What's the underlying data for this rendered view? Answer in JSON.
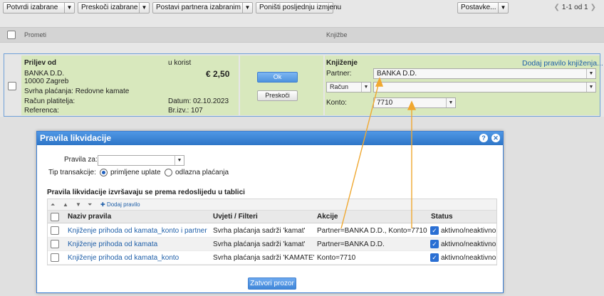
{
  "toolbar": {
    "confirm_selected": "Potvrdi izabrane",
    "skip_selected": "Preskoči izabrane",
    "set_partner": "Postavi partnera izabranim",
    "undo_last": "Poništi posljednju izmjenu",
    "settings": "Postavke...",
    "pager": "1-1 od 1"
  },
  "list_header": {
    "left": "Prometi",
    "right": "Knjižbe"
  },
  "transaction": {
    "inflow_label": "Priljev od",
    "benefit_label": "u korist",
    "amount": "€ 2,50",
    "payer_name": "BANKA D.D.",
    "payer_address": "10000 Zagreb",
    "purpose": "Svrha plaćanja: Redovne kamate",
    "payer_account_label": "Račun platitelja:",
    "reference_label": "Referenca:",
    "date": "Datum: 02.10.2023",
    "statement_no": "Br.izv.: 107",
    "ok_button": "Ok",
    "skip_button": "Preskoči",
    "posting_title": "Knjiženje",
    "add_rule_link": "Dodaj pravilo knjiženja...",
    "partner_label": "Partner:",
    "partner_value": "BANKA D.D.",
    "account_type": "Račun",
    "konto_label": "Konto:",
    "konto_value": "7710"
  },
  "modal": {
    "title": "Pravila likvidacije",
    "rules_for_label": "Pravila za:",
    "rules_for_value": "",
    "tx_type_label": "Tip transakcije:",
    "radio_in": "primljene uplate",
    "radio_out": "odlazna plaćanja",
    "order_note": "Pravila likvidacije izvršavaju se prema redoslijedu u tablici",
    "add_rule": "Dodaj pravilo",
    "columns": [
      "Naziv pravila",
      "Uvjeti / Filteri",
      "Akcije",
      "Status"
    ],
    "rows": [
      {
        "name": "Knjiženje prihoda od kamata_konto i partner",
        "filter": "Svrha plaćanja sadrži 'kamat'",
        "action": "Partner=BANKA D.D., Konto=7710",
        "status": "aktivno/neaktivno"
      },
      {
        "name": "Knjiženje prihoda od kamata",
        "filter": "Svrha plaćanja sadrži 'kamat'",
        "action": "Partner=BANKA D.D.",
        "status": "aktivno/neaktivno"
      },
      {
        "name": "Knjiženje prihoda od kamata_konto",
        "filter": "Svrha plaćanja sadrži 'KAMATE'",
        "action": "Konto=7710",
        "status": "aktivno/neaktivno"
      }
    ],
    "close_button": "Zatvori prozor"
  },
  "colors": {
    "accent": "#2e75c7",
    "panel_green": "#d8e8bd",
    "arrow": "#f0a830"
  }
}
